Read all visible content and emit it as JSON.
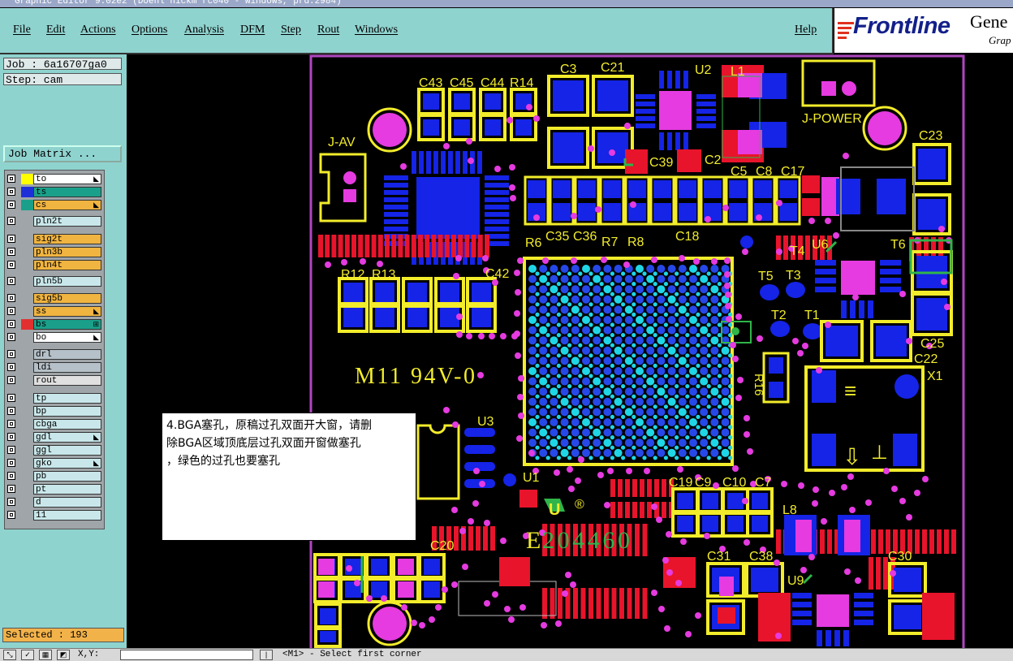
{
  "window": {
    "title": "Graphic Editor 9.02e2 (Doehl nickm rc040 - windows, prd.2984)"
  },
  "menu": {
    "file": "File",
    "edit": "Edit",
    "actions": "Actions",
    "options": "Options",
    "analysis": "Analysis",
    "dfm": "DFM",
    "step": "Step",
    "rout": "Rout",
    "windows": "Windows",
    "help": "Help"
  },
  "logo": {
    "brand": "Frontline",
    "tail1": "Gene",
    "tail2": "Grap"
  },
  "sidebar": {
    "job": "Job : 6a16707ga0",
    "step": "Step: cam",
    "job_matrix": "Job Matrix ...",
    "selected": "Selected : 193",
    "layers": [
      {
        "name": "to",
        "color": "#ffffff",
        "swatch": "#ffff00",
        "mark": "◣"
      },
      {
        "name": "ts",
        "color": "#1aa08a",
        "swatch": "#1f2fd8",
        "mark": ""
      },
      {
        "name": "cs",
        "color": "#f0b440",
        "swatch": "#1aa08a",
        "mark": "◣"
      },
      {
        "name": "pln2t",
        "color": "#c9e7ea",
        "swatch": "",
        "mark": ""
      },
      {
        "name": "sig2t",
        "color": "#f0b440",
        "swatch": "",
        "mark": ""
      },
      {
        "name": "pln3b",
        "color": "#f0b440",
        "swatch": "",
        "mark": ""
      },
      {
        "name": "pln4t",
        "color": "#f0b440",
        "swatch": "",
        "mark": ""
      },
      {
        "name": "pln5b",
        "color": "#c9e7ea",
        "swatch": "",
        "mark": ""
      },
      {
        "name": "sig5b",
        "color": "#f0b440",
        "swatch": "",
        "mark": ""
      },
      {
        "name": "ss",
        "color": "#f0b440",
        "swatch": "",
        "mark": "◣"
      },
      {
        "name": "bs",
        "color": "#1aa08a",
        "swatch": "#e23030",
        "mark": "⊞"
      },
      {
        "name": "bo",
        "color": "#ffffff",
        "swatch": "",
        "mark": "◣"
      },
      {
        "name": "drl",
        "color": "#b5c0c8",
        "swatch": "",
        "mark": ""
      },
      {
        "name": "ldi",
        "color": "#b5c0c8",
        "swatch": "",
        "mark": ""
      },
      {
        "name": "rout",
        "color": "#e0e0e0",
        "swatch": "",
        "mark": ""
      },
      {
        "name": "tp",
        "color": "#c9e7ea",
        "swatch": "",
        "mark": ""
      },
      {
        "name": "bp",
        "color": "#c9e7ea",
        "swatch": "",
        "mark": ""
      },
      {
        "name": "cbga",
        "color": "#c9e7ea",
        "swatch": "",
        "mark": ""
      },
      {
        "name": "gdl",
        "color": "#c9e7ea",
        "swatch": "",
        "mark": "◣"
      },
      {
        "name": "ggl",
        "color": "#c9e7ea",
        "swatch": "",
        "mark": ""
      },
      {
        "name": "gko",
        "color": "#c9e7ea",
        "swatch": "",
        "mark": "◣"
      },
      {
        "name": "pb",
        "color": "#c9e7ea",
        "swatch": "",
        "mark": ""
      },
      {
        "name": "pt",
        "color": "#c9e7ea",
        "swatch": "",
        "mark": ""
      },
      {
        "name": "d",
        "color": "#c9e7ea",
        "swatch": "",
        "mark": ""
      },
      {
        "name": "11",
        "color": "#c9e7ea",
        "swatch": "",
        "mark": ""
      }
    ]
  },
  "pcb": {
    "ref_labels": [
      "C43",
      "C45",
      "C44",
      "R14",
      "C3",
      "C21",
      "U2",
      "L1",
      "J-POWER",
      "J-AV",
      "C23",
      "C39",
      "C2",
      "C5",
      "C8",
      "C17",
      "R6",
      "C35",
      "C36",
      "R7",
      "R8",
      "C18",
      "U6",
      "T4",
      "T6",
      "R12",
      "R13",
      "C42",
      "T5",
      "T3",
      "T2",
      "T1",
      "C25",
      "C22",
      "X1",
      "R16",
      "U3",
      "U1",
      "C19",
      "C9",
      "C10",
      "C7",
      "L8",
      "C31",
      "C38",
      "C30",
      "U9",
      "C20"
    ],
    "marking": "M11 94V-0",
    "ul_number": "E204460",
    "ul_prefix": "E"
  },
  "annotation": {
    "line1": "4.BGA塞孔，原稿过孔双面开大窗，请删",
    "line2": "除BGA区域顶底层过孔双面开窗做塞孔",
    "line3": "，绿色的过孔也要塞孔"
  },
  "statusbar": {
    "coord_label": "X,Y:",
    "prompt": "<M1> - Select first corner"
  }
}
